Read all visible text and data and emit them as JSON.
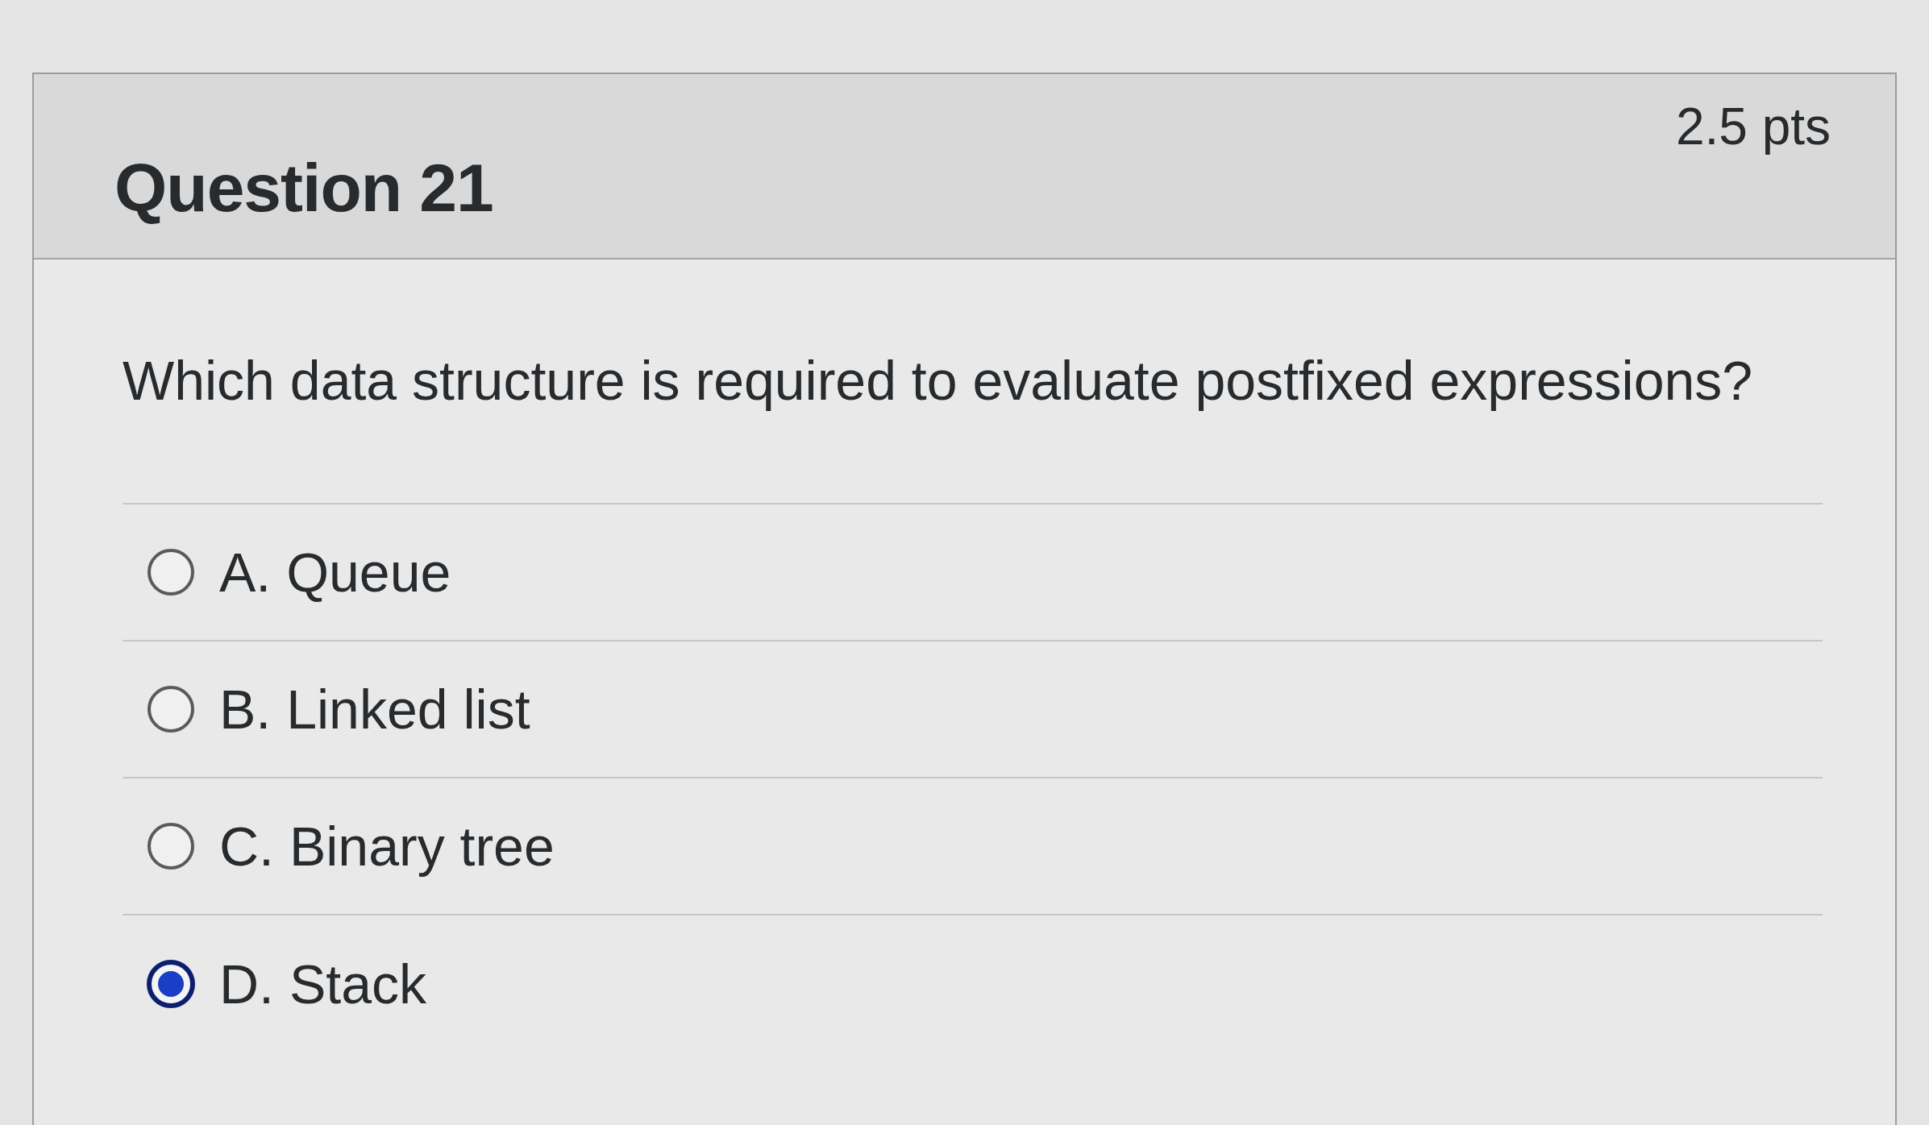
{
  "question": {
    "title": "Question 21",
    "points": "2.5 pts",
    "text": "Which data structure is required to evaluate postfixed expressions?",
    "options": [
      {
        "label": "A. Queue",
        "selected": false
      },
      {
        "label": "B. Linked list",
        "selected": false
      },
      {
        "label": "C. Binary tree",
        "selected": false
      },
      {
        "label": "D. Stack",
        "selected": true
      }
    ]
  }
}
